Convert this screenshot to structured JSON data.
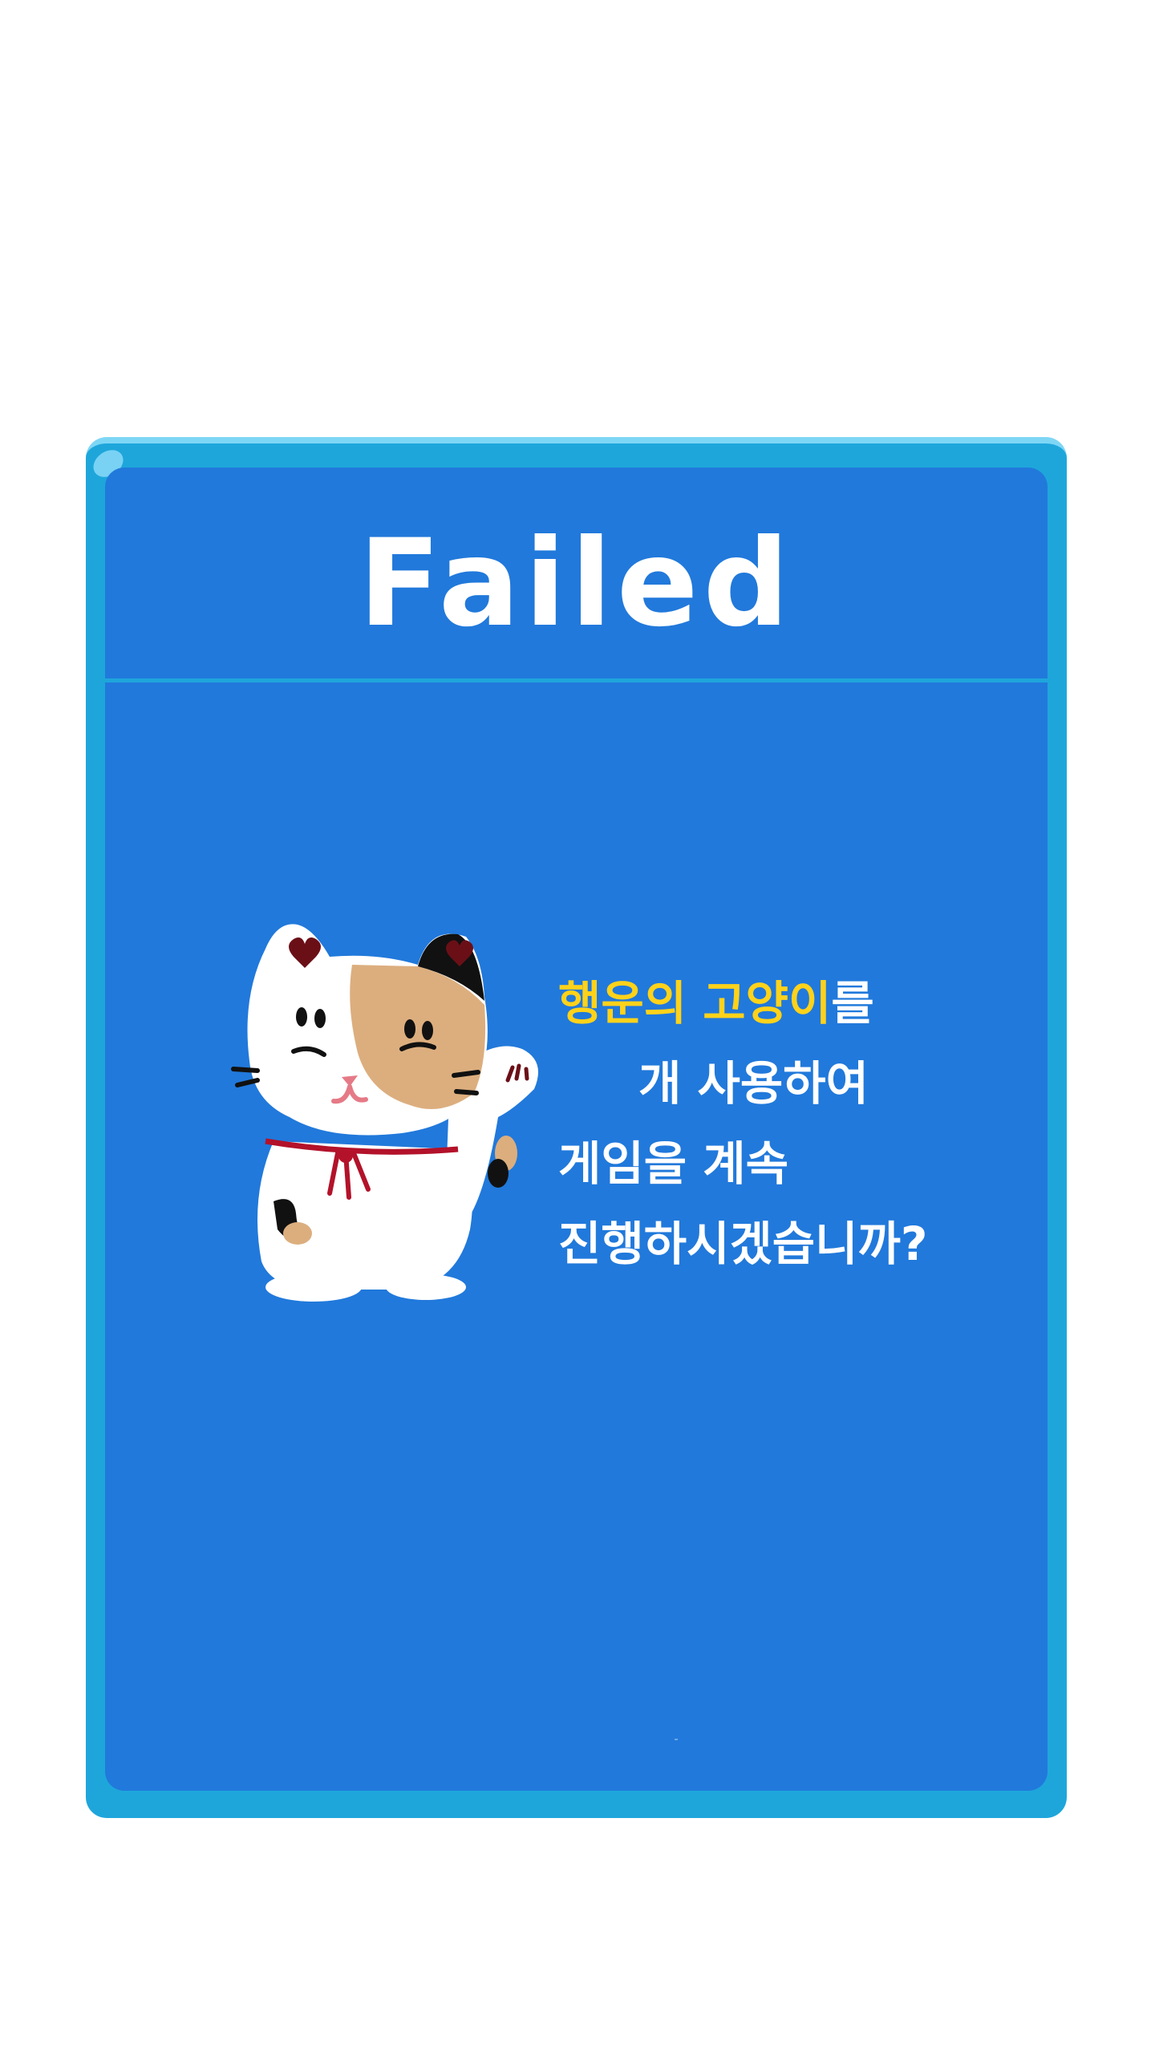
{
  "dialog": {
    "title": "Failed",
    "message": {
      "line1_highlight_a": "행운의",
      "line1_highlight_b": "고양이",
      "line1_suffix": "를",
      "line2": "개 사용하여",
      "line3": "게임을 계속",
      "line4": "진행하시겠습니까?"
    },
    "highlight_color": "#ffd21a"
  },
  "mascot": {
    "icon": "lucky-cat-icon"
  },
  "colors": {
    "frame": "#1ea6db",
    "panel": "#2179db",
    "text": "#ffffff"
  }
}
